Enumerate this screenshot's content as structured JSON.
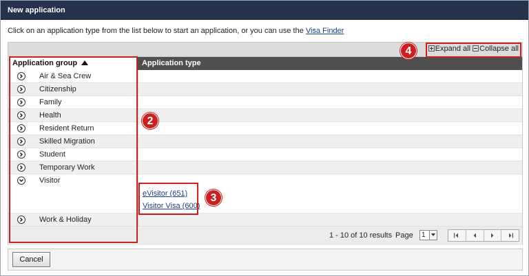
{
  "window": {
    "title": "New application"
  },
  "intro": {
    "text": "Click on an application type from the list below to start an application, or you can use the ",
    "link": "Visa Finder"
  },
  "toolbar": {
    "expand_all": "Expand all",
    "collapse_all": "Collapse all"
  },
  "grid": {
    "col_group": "Application group",
    "col_type": "Application type",
    "groups": [
      {
        "label": "Air & Sea Crew",
        "expanded": false
      },
      {
        "label": "Citizenship",
        "expanded": false
      },
      {
        "label": "Family",
        "expanded": false
      },
      {
        "label": "Health",
        "expanded": false
      },
      {
        "label": "Resident Return",
        "expanded": false
      },
      {
        "label": "Skilled Migration",
        "expanded": false
      },
      {
        "label": "Student",
        "expanded": false
      },
      {
        "label": "Temporary Work",
        "expanded": false
      },
      {
        "label": "Visitor",
        "expanded": true,
        "types": [
          "eVisitor (651)",
          "Visitor Visa (600)"
        ]
      },
      {
        "label": "Work & Holiday",
        "expanded": false
      }
    ]
  },
  "pager": {
    "results": "1 - 10 of 10 results",
    "page_label": "Page",
    "page_value": "1"
  },
  "footer": {
    "cancel": "Cancel"
  },
  "annotations": {
    "badge_2": "2",
    "badge_3": "3",
    "badge_4": "4"
  },
  "colors": {
    "titlebar": "#25324c",
    "callout": "#cc1f1f",
    "header_dark": "#4f4f4f"
  }
}
